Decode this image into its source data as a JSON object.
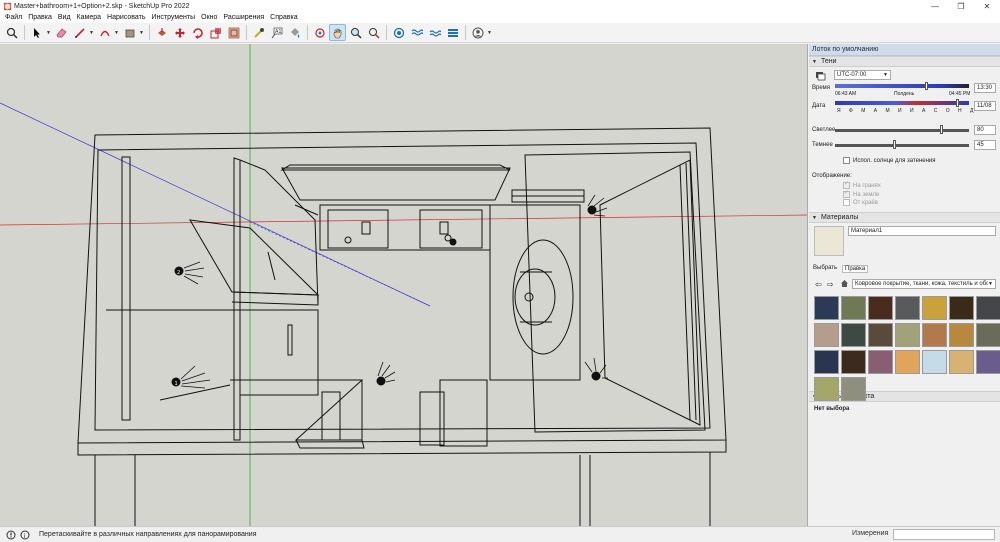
{
  "window": {
    "title": "Master+bathroom+1+Option+2.skp - SketchUp Pro 2022",
    "minimize": "—",
    "maximize": "❐",
    "close": "✕"
  },
  "menu": [
    "Файл",
    "Правка",
    "Вид",
    "Камера",
    "Нарисовать",
    "Инструменты",
    "Окно",
    "Расширения",
    "Справка"
  ],
  "toolbar": {
    "tools": [
      "search-icon",
      "select-arrow-icon",
      "eraser-icon",
      "pencil-line-icon",
      "arc-icon",
      "shape-rect-icon",
      "push-pull-icon",
      "move-icon",
      "rotate-icon",
      "scale-icon",
      "offset-icon",
      "tape-measure-icon",
      "text-icon",
      "paint-bucket-icon",
      "orbit-icon",
      "pan-hand-icon",
      "zoom-icon",
      "zoom-extents-icon",
      "warehouse-icon",
      "extensions-icon",
      "sandbox-icon",
      "section-icon",
      "user-account-icon"
    ],
    "active_tool": "pan-hand-icon"
  },
  "tray": {
    "title": "Лоток по умолчанию",
    "shadows": {
      "header": "Тени",
      "timezone": "UTC-07:00",
      "time_label": "Время",
      "time_start": "06:43 AM",
      "time_mid": "Полдень",
      "time_end": "04:45 PM",
      "time_value": "13:30",
      "date_label": "Дата",
      "months": "Я Ф М А М И И А С О Н Д",
      "date_value": "11/08",
      "light_label": "Светлее",
      "light_value": "80",
      "dark_label": "Темнее",
      "dark_value": "45",
      "sun_shading": "Испол. солнце для затенения",
      "display_label": "Отображение:",
      "on_faces": "На гранях",
      "on_ground": "На земле",
      "from_edges": "От краёв"
    },
    "materials": {
      "header": "Материалы",
      "name": "Материал1",
      "tab_select": "Выбрать",
      "tab_edit": "Правка",
      "collection": "Ковровое покрытие, ткани, кожа, текстиль и обои",
      "swatch_colors": [
        "#2b3b57",
        "#6f7a55",
        "#4a2c1e",
        "#585a5c",
        "#c9a23b",
        "#3a2a18",
        "#44464a",
        "#b59d8c",
        "#3d4a44",
        "#5a4a3c",
        "#a2a27a",
        "#b07a4c",
        "#b7893e",
        "#6b6b5a",
        "#2a3550",
        "#3c2a1c",
        "#8a5e72",
        "#e0a45a",
        "#c6dbe8",
        "#d8b272",
        "#6a5d8c",
        "#a5a76a",
        "#8f8f7e"
      ]
    },
    "entity": {
      "header": "Данные объекта",
      "value": "Нет выбора"
    }
  },
  "status": {
    "hint": "Перетаскивайте в различных направлениях для панорамирования",
    "measure_label": "Измерения",
    "measure_value": ""
  },
  "viewport": {
    "labels": [
      "2",
      "1"
    ]
  }
}
